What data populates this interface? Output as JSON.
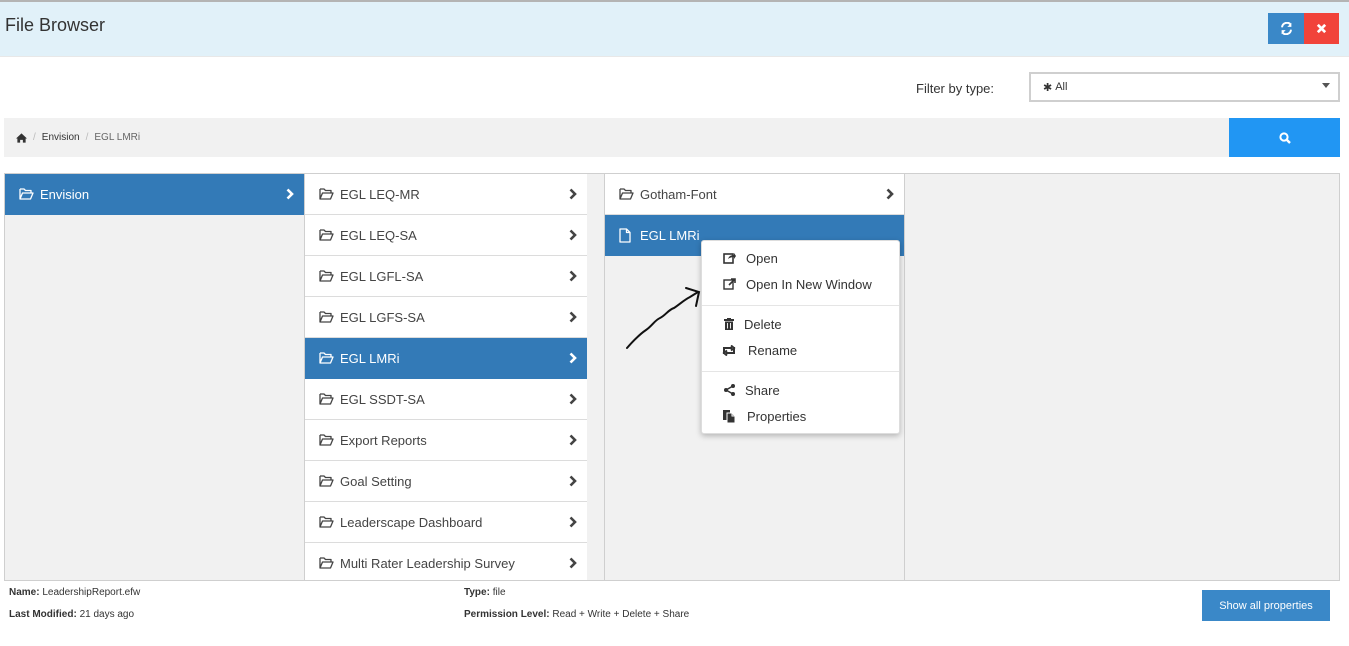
{
  "header": {
    "title": "File Browser",
    "refresh_icon": "refresh-icon",
    "close_icon": "close-icon"
  },
  "filter": {
    "label": "Filter by type:",
    "selected_icon": "asterisk-icon",
    "selected": "All"
  },
  "breadcrumb": {
    "home_icon": "home-icon",
    "separator": "/",
    "items": [
      "Envision",
      "EGL LMRi"
    ]
  },
  "search": {
    "icon": "search-icon"
  },
  "columns": {
    "col1": [
      {
        "label": "Envision",
        "type": "folder",
        "selected": true
      }
    ],
    "col2": [
      {
        "label": "EGL LEQ-MR",
        "type": "folder",
        "selected": false
      },
      {
        "label": "EGL LEQ-SA",
        "type": "folder",
        "selected": false
      },
      {
        "label": "EGL LGFL-SA",
        "type": "folder",
        "selected": false
      },
      {
        "label": "EGL LGFS-SA",
        "type": "folder",
        "selected": false
      },
      {
        "label": "EGL LMRi",
        "type": "folder",
        "selected": true
      },
      {
        "label": "EGL SSDT-SA",
        "type": "folder",
        "selected": false
      },
      {
        "label": "Export Reports",
        "type": "folder",
        "selected": false
      },
      {
        "label": "Goal Setting",
        "type": "folder",
        "selected": false
      },
      {
        "label": "Leaderscape Dashboard",
        "type": "folder",
        "selected": false
      },
      {
        "label": "Multi Rater Leadership Survey",
        "type": "folder",
        "selected": false
      }
    ],
    "col3": [
      {
        "label": "Gotham-Font",
        "type": "folder",
        "selected": false
      },
      {
        "label": "EGL LMRi",
        "type": "file",
        "selected": true
      }
    ]
  },
  "context_menu": {
    "items": [
      {
        "label": "Open",
        "icon": "open-icon"
      },
      {
        "label": "Open In New Window",
        "icon": "external-link-icon"
      },
      {
        "label": "Delete",
        "icon": "trash-icon"
      },
      {
        "label": "Rename",
        "icon": "rename-icon"
      },
      {
        "label": "Share",
        "icon": "share-icon"
      },
      {
        "label": "Properties",
        "icon": "properties-icon"
      }
    ]
  },
  "details": {
    "name_label": "Name:",
    "name_value": "LeadershipReport.efw",
    "modified_label": "Last Modified:",
    "modified_value": "21 days ago",
    "type_label": "Type:",
    "type_value": "file",
    "permission_label": "Permission Level:",
    "permission_value": "Read + Write + Delete + Share",
    "show_all_label": "Show all properties"
  },
  "colors": {
    "selected_blue": "#337ab7",
    "search_blue": "#2196f3",
    "close_red": "#f1433a",
    "header_bg": "#e1f1f9"
  }
}
